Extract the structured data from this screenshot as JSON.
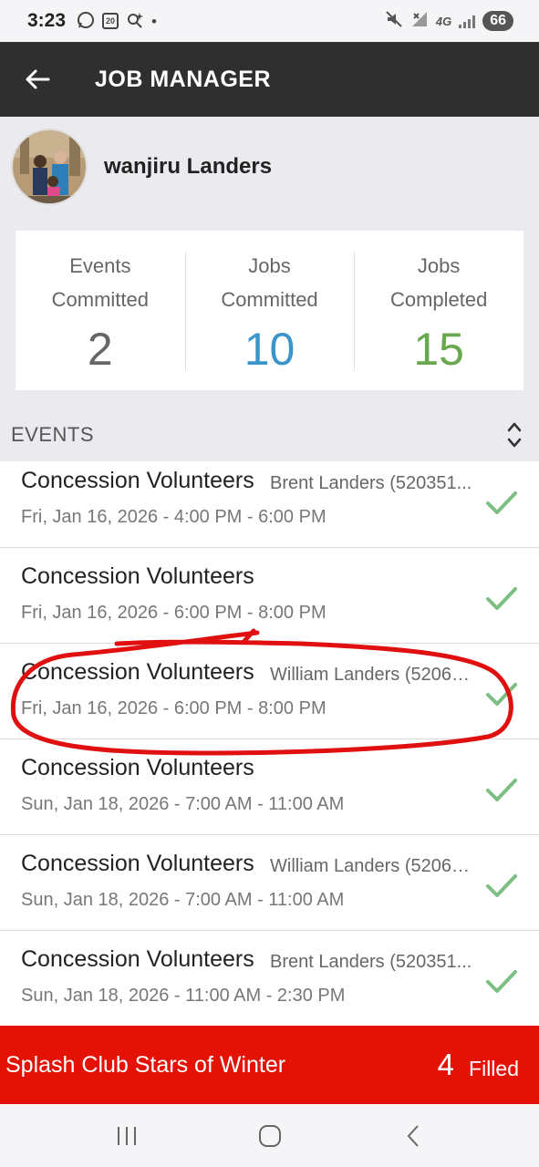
{
  "status_bar": {
    "time": "3:23",
    "calendar_day": "20",
    "network": "4G",
    "battery": "66"
  },
  "app_bar": {
    "title": "JOB MANAGER",
    "back_icon": "arrow-left-icon"
  },
  "profile": {
    "name": "wanjiru Landers"
  },
  "stats": [
    {
      "label": "Events Committed",
      "value": "2",
      "color": "#666666"
    },
    {
      "label": "Jobs Committed",
      "value": "10",
      "color": "#3a95c8"
    },
    {
      "label": "Jobs Completed",
      "value": "15",
      "color": "#6aa84f"
    }
  ],
  "events_header": {
    "title": "EVENTS",
    "sort_icon": "chevron-up-down-icon"
  },
  "events": [
    {
      "name": "Concession Volunteers",
      "person": "Brent Landers (520351...",
      "date": "Fri, Jan 16, 2026 - 4:00 PM - 6:00 PM"
    },
    {
      "name": "Concession Volunteers",
      "person": "",
      "date": "Fri, Jan 16, 2026 - 6:00 PM - 8:00 PM"
    },
    {
      "name": "Concession Volunteers",
      "person": "William Landers (52061...",
      "date": "Fri, Jan 16, 2026 - 6:00 PM - 8:00 PM"
    },
    {
      "name": "Concession Volunteers",
      "person": "",
      "date": "Sun, Jan 18, 2026 - 7:00 AM - 11:00 AM"
    },
    {
      "name": "Concession Volunteers",
      "person": "William Landers (52061...",
      "date": "Sun, Jan 18, 2026 - 7:00 AM - 11:00 AM"
    },
    {
      "name": "Concession Volunteers",
      "person": "Brent Landers (520351...",
      "date": "Sun, Jan 18, 2026 - 11:00 AM - 2:30 PM"
    }
  ],
  "footer": {
    "title": "Splash Club Stars of Winter",
    "count": "4",
    "status": "Filled",
    "color": "#e41205"
  },
  "colors": {
    "check": "#7cbf82",
    "annotation": "#e01010"
  }
}
